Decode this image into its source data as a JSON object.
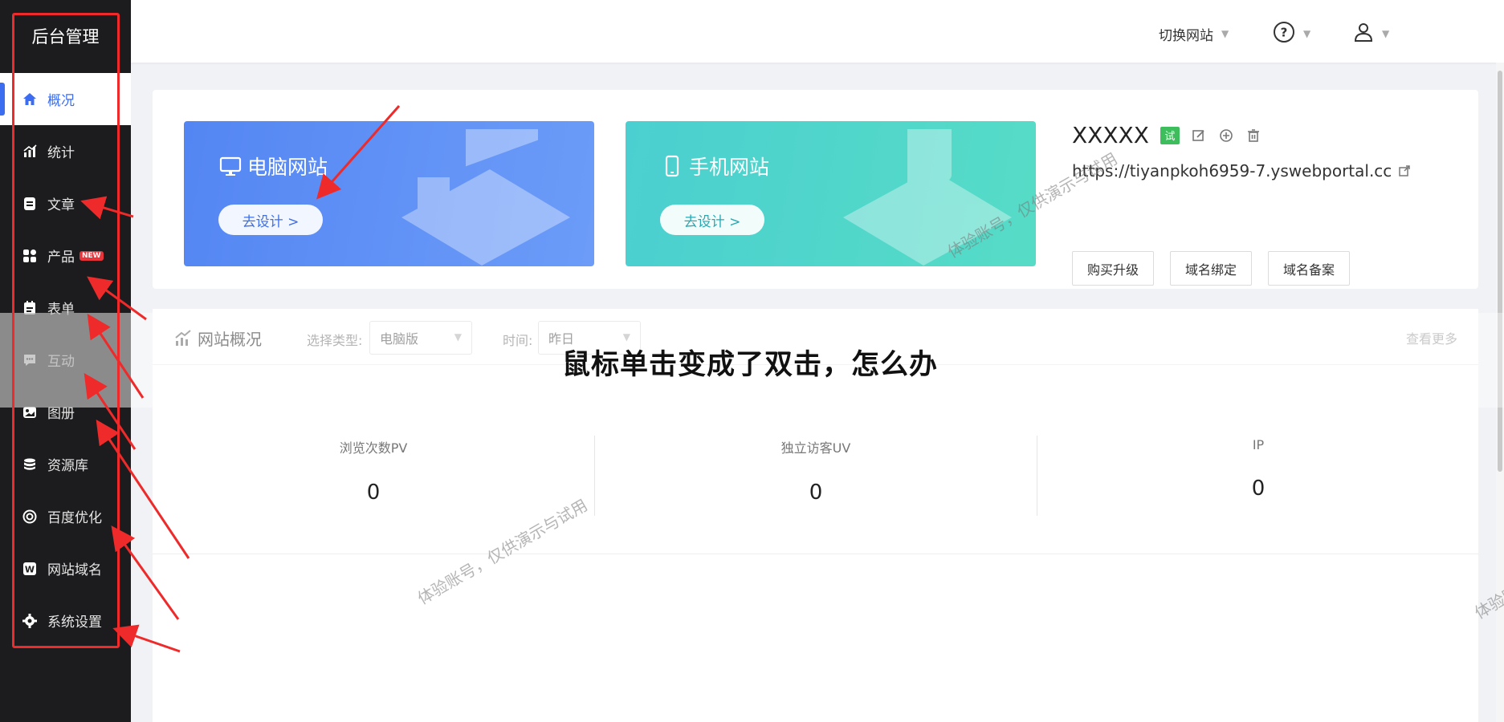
{
  "sidebar": {
    "brand": "后台管理",
    "items": [
      {
        "label": "概况",
        "icon": "home-icon"
      },
      {
        "label": "统计",
        "icon": "chart-icon"
      },
      {
        "label": "文章",
        "icon": "article-icon"
      },
      {
        "label": "产品",
        "icon": "product-icon",
        "badge": "NEW"
      },
      {
        "label": "表单",
        "icon": "form-icon"
      },
      {
        "label": "互动",
        "icon": "chat-icon"
      },
      {
        "label": "图册",
        "icon": "album-icon"
      },
      {
        "label": "资源库",
        "icon": "database-icon"
      },
      {
        "label": "百度优化",
        "icon": "target-icon"
      },
      {
        "label": "网站域名",
        "icon": "domain-icon"
      },
      {
        "label": "系统设置",
        "icon": "gear-icon"
      }
    ]
  },
  "header": {
    "switch_site": "切换网站",
    "help_icon": "help-icon",
    "user_icon": "user-icon"
  },
  "site": {
    "pc_tile": {
      "title": "电脑网站",
      "button": "去设计 >"
    },
    "mobile_tile": {
      "title": "手机网站",
      "button": "去设计 >"
    },
    "name": "XXXXX",
    "trial_badge": "试",
    "url": "https://tiyanpkoh6959-7.yswebportal.cc",
    "buttons": [
      "购买升级",
      "域名绑定",
      "域名备案"
    ]
  },
  "overview": {
    "title": "网站概况",
    "type_label": "选择类型:",
    "type_value": "电脑版",
    "time_label": "时间:",
    "time_value": "昨日",
    "more": "查看更多",
    "stats": [
      {
        "label": "浏览次数PV",
        "value": "0"
      },
      {
        "label": "独立访客UV",
        "value": "0"
      },
      {
        "label": "IP",
        "value": "0"
      }
    ]
  },
  "caption": "鼠标单击变成了双击，怎么办",
  "watermark": "体验账号，仅供演示与试用",
  "watermark_partial": "体验账号",
  "colors": {
    "sidebar_bg": "#1c1c1e",
    "accent_blue": "#3c6df0",
    "annotation_red": "#ee2a2a",
    "trial_green": "#3dbd5b"
  }
}
